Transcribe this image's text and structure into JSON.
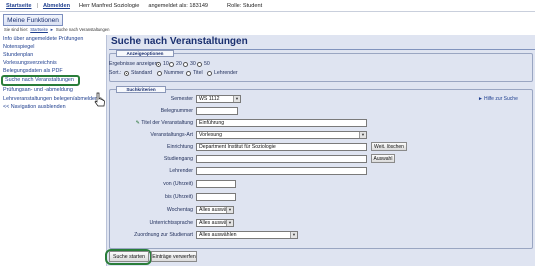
{
  "topbar": {
    "start": "Startseite",
    "separator": "|",
    "logout": "Abmelden",
    "user": "Herr Manfred Soziologie",
    "logged_in": "angemeldet als: 183149",
    "role": "Rolle: Student"
  },
  "menu_button": "Meine Funktionen",
  "breadcrumb": {
    "prefix": "Sie sind hier:",
    "home": "Startseite",
    "arrow": "►",
    "current": "Suche nach Veranstaltungen"
  },
  "sidebar": {
    "items": [
      "Info über angemeldete Prüfungen",
      "Notenspiegel",
      "Stundenplan",
      "Vorlesungsverzeichnis",
      "Belegungsdaten als PDF",
      "Suche nach Veranstaltungen",
      "Prüfungsan- und -abmeldung",
      "Lehrveranstaltungen belegen/abmelden",
      "<< Navigation ausblenden"
    ]
  },
  "main": {
    "title": "Suche nach Veranstaltungen",
    "display_options": {
      "legend": "Anzeigeoptionen",
      "results_label": "Ergebnisse anzeigen:",
      "results_options": [
        "10",
        "20",
        "30",
        "50"
      ],
      "results_selected": "10",
      "sort_label": "Sort.:",
      "sort_options": [
        "Standard",
        "Nummer",
        "Titel",
        "Lehrender"
      ],
      "sort_selected": "Standard"
    },
    "criteria": {
      "legend": "Suchkriterien",
      "help_arrow": "►",
      "help": "Hilfe zur Suche",
      "semester_label": "Semester",
      "semester_value": "WS 1112",
      "belegnummer_label": "Belegnummer",
      "belegnummer_value": "",
      "titel_label": "Titel der Veranstaltung",
      "titel_value": "Einführung",
      "art_label": "Veranstaltungs-Art",
      "art_value": "Vorlesung",
      "einrichtung_label": "Einrichtung",
      "einrichtung_value": "Department Institut für Soziologie",
      "weiter_button": "Weit. löschen",
      "studiengang_label": "Studiengang",
      "studiengang_value": "",
      "auswahl_button": "Auswahl",
      "lehrender_label": "Lehrender",
      "lehrender_value": "",
      "von_label": "von (Uhrzeit)",
      "von_value": "",
      "bis_label": "bis (Uhrzeit)",
      "bis_value": "",
      "wochentag_label": "Wochentag",
      "wochentag_value": "Alles auswä",
      "sprache_label": "Unterrichtssprache",
      "sprache_value": "Alles auswä",
      "zuordnung_label": "Zuordnung zur Studienart",
      "zuordnung_value": "Alles auswählen"
    },
    "search_button": "Suche starten",
    "reset_button": "Einträge verwerfen"
  },
  "colors": {
    "highlight": "#2a7d3a",
    "panel": "#dfe4f1",
    "link": "#1f3f8f"
  }
}
